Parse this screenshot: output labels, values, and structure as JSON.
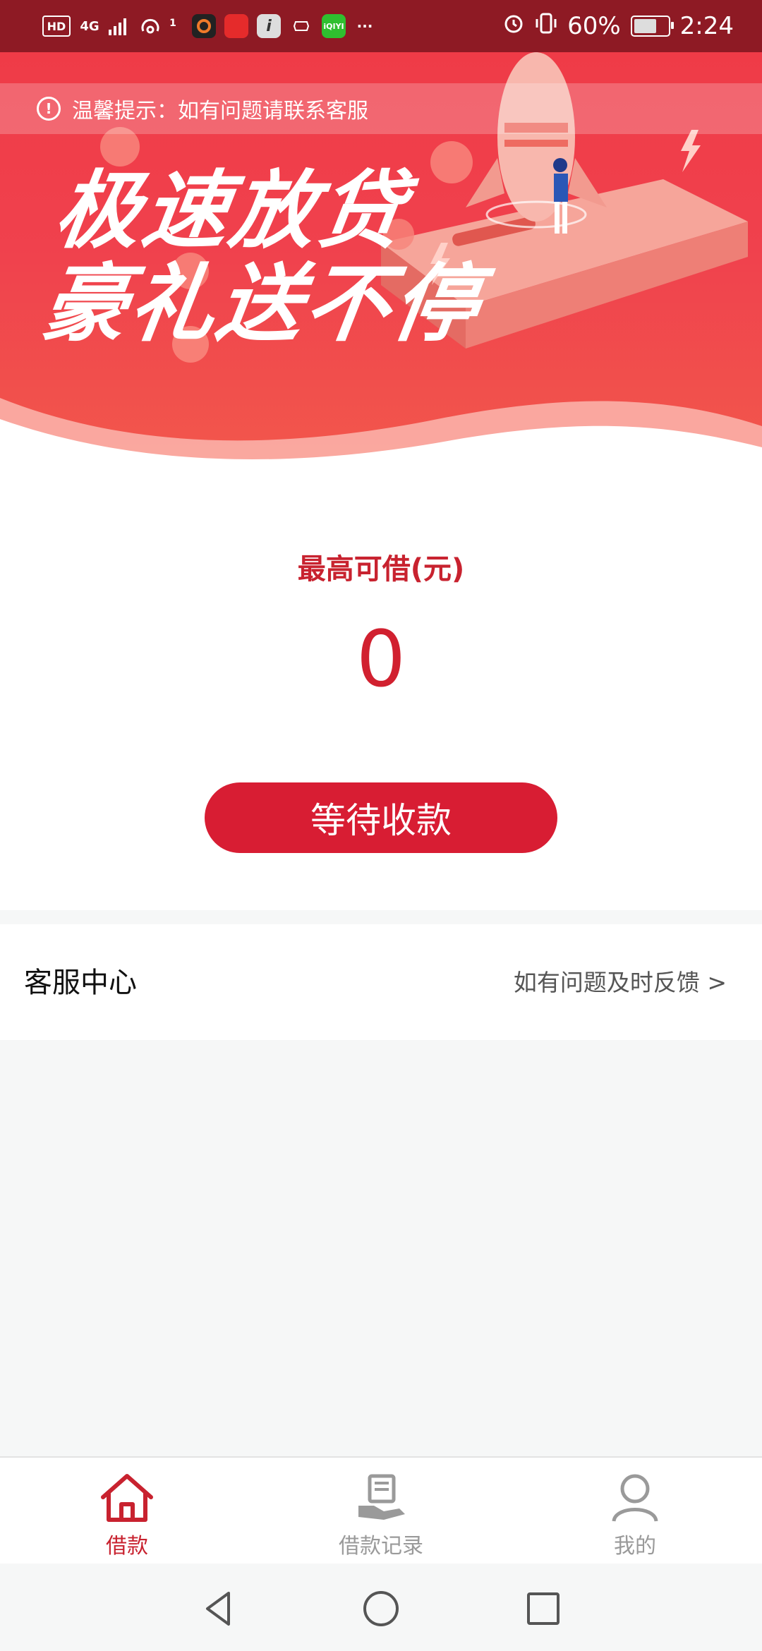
{
  "status_bar": {
    "hd": "HD",
    "network": "4G",
    "hotspot_count": "1",
    "app_icons": [
      "orange-circle-app-icon",
      "red-app-icon",
      "info-app-icon",
      "hand-app-icon",
      "iqiyi-app-icon"
    ],
    "more": "···",
    "battery_percent": "60%",
    "time": "2:24"
  },
  "banner": {
    "notice_text": "温馨提示：如有问题请联系客服",
    "slogan_line1": "极速放贷",
    "slogan_line2": "豪礼送不停"
  },
  "loan_card": {
    "label": "最高可借(元)",
    "amount": "0",
    "button_label": "等待收款"
  },
  "service_center": {
    "title": "客服中心",
    "link_text": "如有问题及时反馈 >"
  },
  "bottom_nav": {
    "items": [
      {
        "label": "借款",
        "icon": "home-icon",
        "active": true
      },
      {
        "label": "借款记录",
        "icon": "loan-record-icon",
        "active": false
      },
      {
        "label": "我的",
        "icon": "profile-icon",
        "active": false
      }
    ]
  },
  "colors": {
    "primary": "#d81d33",
    "status_bar": "#8e1a24",
    "banner": "#ef3b47"
  }
}
